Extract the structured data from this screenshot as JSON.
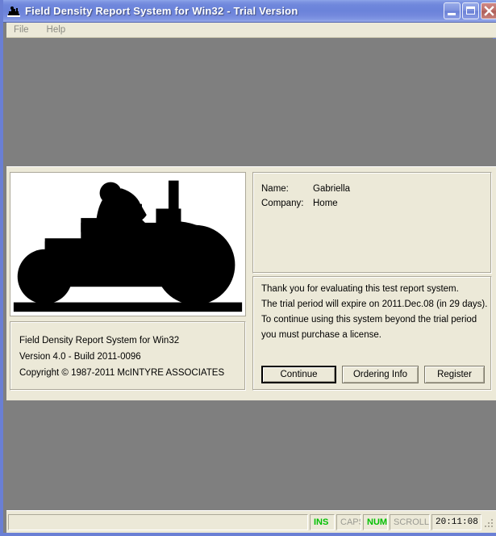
{
  "window": {
    "title": "Field Density Report System for Win32 - Trial Version",
    "icon": "tractor-icon",
    "controls": {
      "minimize": "Minimize",
      "maximize": "Maximize",
      "close": "Close"
    }
  },
  "menubar": {
    "items": [
      {
        "label": "File"
      },
      {
        "label": "Help"
      }
    ]
  },
  "about": {
    "image_alt": "tractor-silhouette-logo",
    "version_lines": [
      "Field Density Report System for Win32",
      "Version 4.0 - Build 2011-0096",
      "Copyright © 1987-2011 McINTYRE ASSOCIATES"
    ],
    "registration": {
      "name_label": "Name:",
      "name_value": "Gabriella",
      "company_label": "Company:",
      "company_value": "Home"
    },
    "trial_lines": [
      "Thank you for evaluating this test report system.",
      "The trial period will expire on 2011.Dec.08 (in 29 days).",
      "To continue using this system beyond the trial period",
      "you must purchase a license."
    ],
    "buttons": {
      "continue": "Continue",
      "ordering_info": "Ordering Info",
      "register": "Register"
    }
  },
  "statusbar": {
    "message": "",
    "indicators": [
      {
        "label": "INS",
        "active": true
      },
      {
        "label": "CAPS",
        "active": false
      },
      {
        "label": "NUM",
        "active": true
      },
      {
        "label": "SCROLL",
        "active": false
      }
    ],
    "clock": "20:11:08"
  },
  "colors": {
    "title_bar_blue": "#6b83da",
    "window_border_blue": "#6a7fd4",
    "face": "#ece9d8",
    "client_gray": "#7f7f7f",
    "indicator_on": "#00c000",
    "indicator_off": "#9a9a92"
  }
}
